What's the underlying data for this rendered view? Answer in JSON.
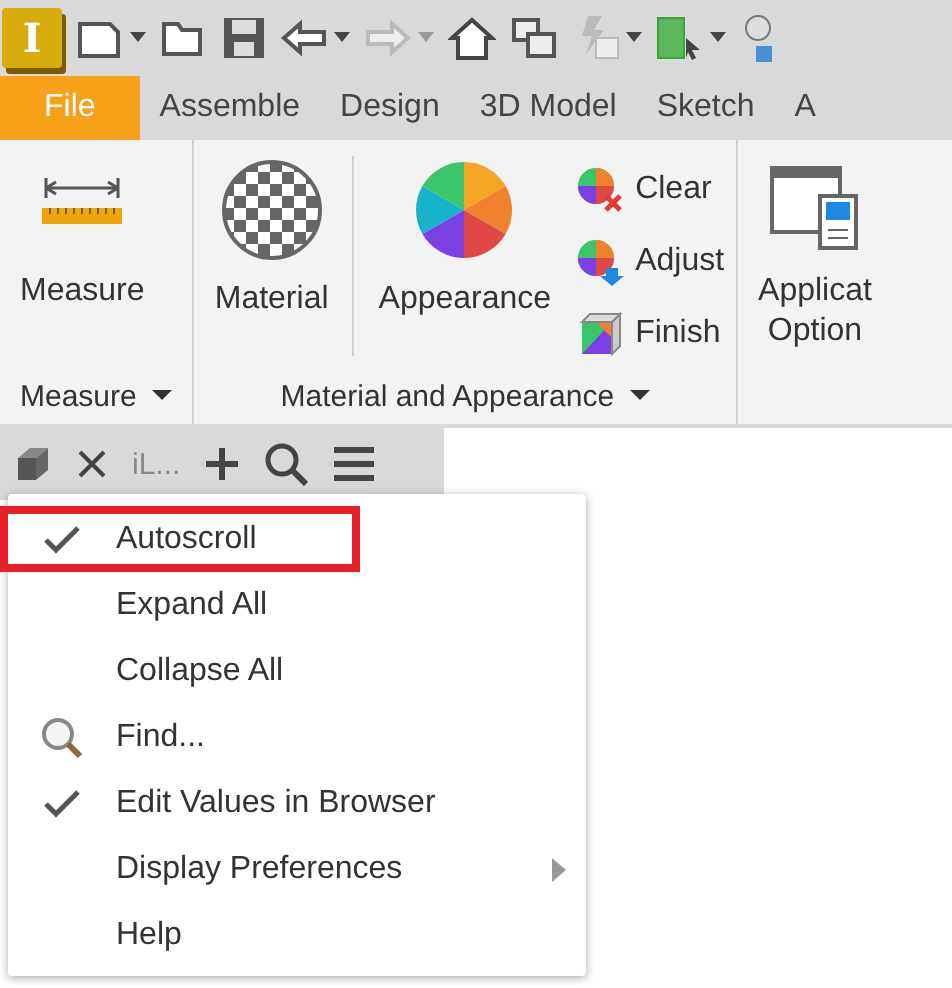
{
  "app_logo": "I",
  "ribbon_tabs": [
    {
      "label": "File",
      "selected": true
    },
    {
      "label": "Assemble",
      "selected": false
    },
    {
      "label": "Design",
      "selected": false
    },
    {
      "label": "3D Model",
      "selected": false
    },
    {
      "label": "Sketch",
      "selected": false
    },
    {
      "label": "A",
      "selected": false
    }
  ],
  "ribbon_panels": [
    {
      "title": "Measure",
      "buttons": [
        {
          "kind": "large",
          "label": "Measure"
        }
      ]
    },
    {
      "title": "Material and Appearance",
      "buttons": [
        {
          "kind": "large",
          "label": "Material"
        },
        {
          "kind": "large",
          "label": "Appearance"
        },
        {
          "kind": "small",
          "label": "Clear"
        },
        {
          "kind": "small",
          "label": "Adjust"
        },
        {
          "kind": "small",
          "label": "Finish"
        }
      ]
    },
    {
      "buttons": [
        {
          "kind": "large",
          "label": "Applicat\nOption"
        }
      ]
    }
  ],
  "browser_tab": {
    "label": "iL..."
  },
  "context_menu": {
    "items": [
      {
        "label": "Autoscroll",
        "checked": true,
        "highlighted": true
      },
      {
        "label": "Expand All",
        "checked": false,
        "highlighted": false
      },
      {
        "label": "Collapse All",
        "checked": false,
        "highlighted": false
      },
      {
        "label": "Find...",
        "checked": false,
        "highlighted": false,
        "kind": "find"
      },
      {
        "label": "Edit Values in Browser",
        "checked": true,
        "highlighted": false
      },
      {
        "label": "Display Preferences",
        "checked": false,
        "highlighted": false,
        "submenu": true
      },
      {
        "label": "Help",
        "checked": false,
        "highlighted": false
      }
    ]
  }
}
